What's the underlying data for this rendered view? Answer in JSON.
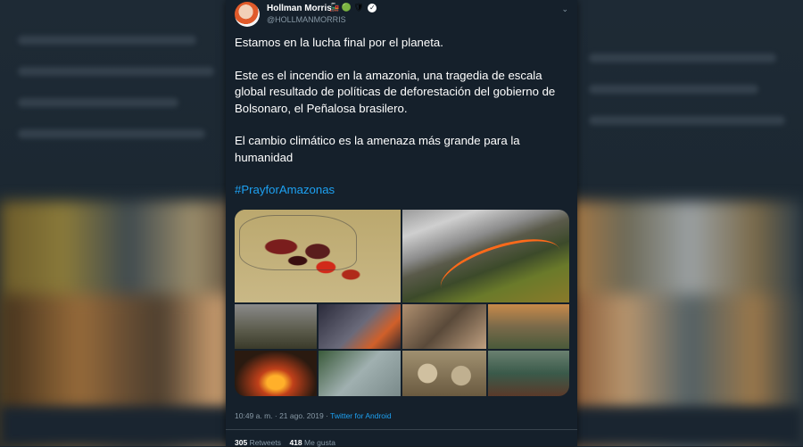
{
  "tweet": {
    "author_name": "Hollman Morris",
    "author_emojis": "🚂 🟢 🛡",
    "author_handle": "@HOLLMANMORRIS",
    "paragraphs": [
      "Estamos en la lucha final por el planeta.",
      "Este es el incendio en la amazonia, una tragedia de escala global resultado de políticas de deforestación del gobierno de Bolsonaro, el Peñalosa brasilero.",
      "El cambio climático es la amenaza más grande para la humanidad"
    ],
    "hashtag": "#PrayforAmazonas",
    "timestamp": "10:49 a. m. · 21 ago. 2019 · ",
    "source": "Twitter for Android",
    "retweets_count": "305",
    "retweets_label": "Retweets",
    "likes_count": "418",
    "likes_label": "Me gusta"
  },
  "icons": {
    "verified": "✓",
    "chevron": "⌄"
  }
}
